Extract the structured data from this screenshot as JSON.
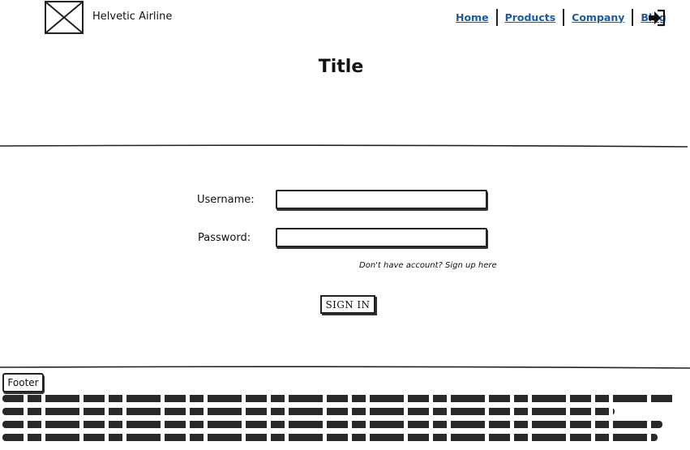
{
  "header": {
    "brand": "Helvetic Airline",
    "nav": [
      {
        "label": "Home"
      },
      {
        "label": "Products"
      },
      {
        "label": "Company"
      },
      {
        "label": "Blog"
      }
    ],
    "login_icon": "sign-in-icon",
    "logo_icon": "image-placeholder-icon"
  },
  "main": {
    "title": "Title",
    "form": {
      "username_label": "Username:",
      "username_value": "",
      "password_label": "Password:",
      "password_value": "",
      "signup_text": "Don't have account? Sign up here",
      "submit_label": "SIGN IN"
    }
  },
  "footer": {
    "label": "Footer"
  },
  "colors": {
    "link": "#1a5ba6",
    "ink": "#111111"
  }
}
